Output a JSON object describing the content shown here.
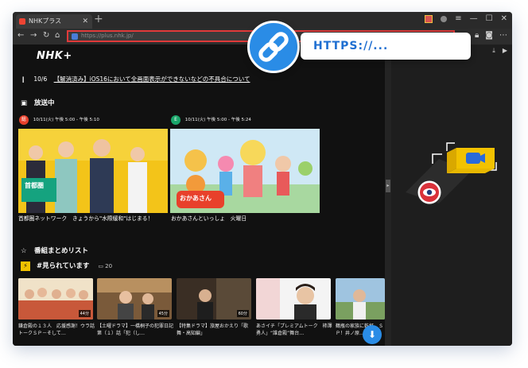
{
  "browser": {
    "tab_title": "NHKプラス",
    "tab_close": "✕",
    "new_tab": "+",
    "url": "https://plus.nhk.jp/"
  },
  "site": {
    "logo": "NHK+"
  },
  "news": {
    "date": "10/6",
    "text": "【解消済み】iOS16において全画面表示ができないなどの不具合について"
  },
  "now_airing": {
    "title": "放送中",
    "items": [
      {
        "channel_logo": "総",
        "channel_color": "#e8402b",
        "time": "10/11(火) 午後 5:00 - 午後 5:10",
        "caption": "首都圏ネットワーク　きょうから\"水際緩和\"はじまる！"
      },
      {
        "channel_logo": "E",
        "channel_color": "#1aa56a",
        "time": "10/11(火) 午後 5:00 - 午後 5:24",
        "caption": "おかあさんといっしょ　火曜日"
      }
    ]
  },
  "programs": {
    "title": "番組まとめリスト",
    "trending_title": "#見られています",
    "trending_count": "20",
    "items": [
      {
        "duration": "44分",
        "caption": "鎌倉殿の１３人　応援感謝！ウラ話トークＳＰ－そして…"
      },
      {
        "duration": "45分",
        "caption": "【土曜ドラマ】一橋桐子の犯罪日記　第（１）話「犯（し…"
      },
      {
        "duration": "60分",
        "caption": "【特集ドラマ】旅屋おかえり「歌舞・高知編」"
      },
      {
        "duration": "",
        "caption": "あさイチ「プレミアムトーク　柿澤勇人」“誰倉殿”舞台…"
      },
      {
        "duration": "",
        "caption": "鶴瓶の家族に乾杯　ＳＰ！井ノ原…"
      }
    ]
  },
  "overlay": {
    "url_label": "HTTPS://..."
  },
  "colors": {
    "accent": "#2a8ce6",
    "highlight": "#e03a3a"
  }
}
